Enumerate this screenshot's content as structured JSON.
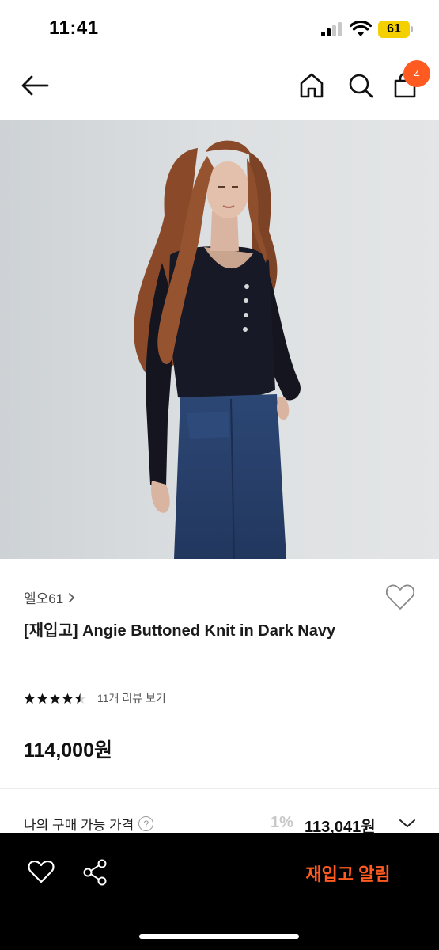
{
  "status_bar": {
    "time": "11:41",
    "battery": "61"
  },
  "nav": {
    "icons": [
      "back-arrow-icon",
      "home-icon",
      "search-icon",
      "cart-icon"
    ],
    "cart_count": "4"
  },
  "product": {
    "brand": "엘오61",
    "title": "[재입고] Angie Buttoned Knit in Dark Navy",
    "rating": 4.5,
    "review_link": "11개 리뷰 보기",
    "price": "114,000원"
  },
  "purchase": {
    "label": "나의 구매 가능 가격",
    "help": "?",
    "discount": "1%",
    "final_price": "113,041원"
  },
  "bottom_bar": {
    "restock_label": "재입고 알림"
  },
  "colors": {
    "accent": "#ff5a1f",
    "bottom_bar": "#000000"
  }
}
